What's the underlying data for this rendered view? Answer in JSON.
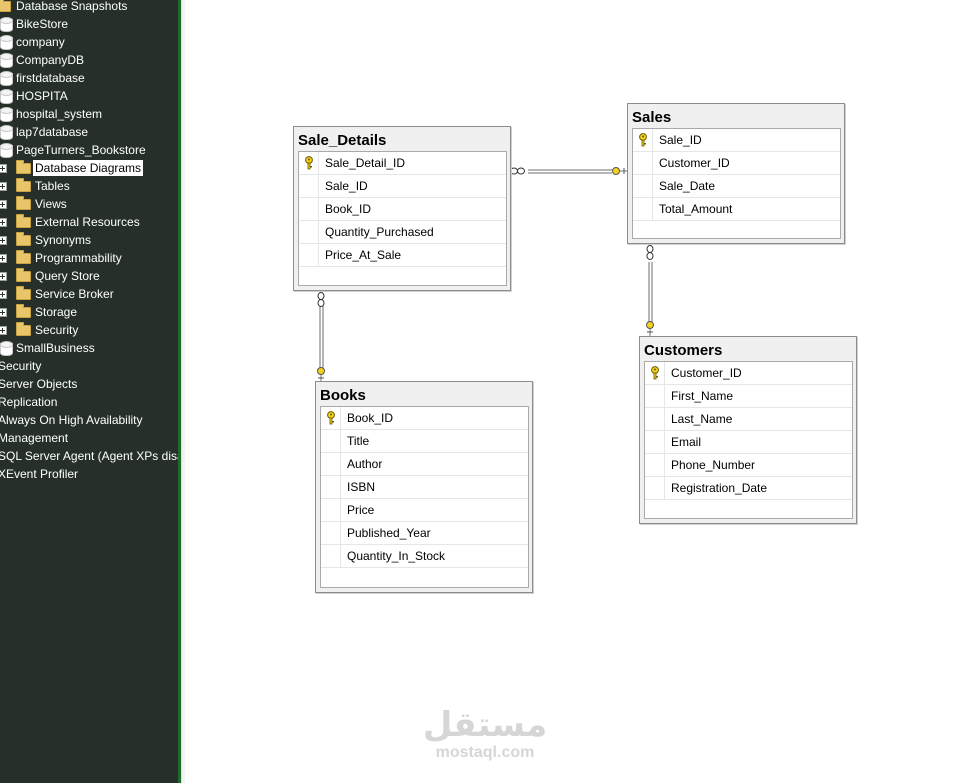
{
  "explorer": {
    "items": [
      {
        "label": "Database Snapshots",
        "icon": "folder-icon",
        "expander": false,
        "selected": false
      },
      {
        "label": "BikeStore",
        "icon": "database-icon",
        "expander": false,
        "selected": false
      },
      {
        "label": "company",
        "icon": "database-icon",
        "expander": false,
        "selected": false
      },
      {
        "label": "CompanyDB",
        "icon": "database-icon",
        "expander": false,
        "selected": false
      },
      {
        "label": "firstdatabase",
        "icon": "database-icon",
        "expander": false,
        "selected": false
      },
      {
        "label": "HOSPITA",
        "icon": "database-icon",
        "expander": false,
        "selected": false
      },
      {
        "label": "hospital_system",
        "icon": "database-icon",
        "expander": false,
        "selected": false
      },
      {
        "label": "lap7database",
        "icon": "database-icon",
        "expander": false,
        "selected": false
      },
      {
        "label": "PageTurners_Bookstore",
        "icon": "database-icon",
        "expander": false,
        "selected": false
      },
      {
        "label": "Database Diagrams",
        "icon": "folder-icon",
        "expander": true,
        "selected": true
      },
      {
        "label": "Tables",
        "icon": "folder-icon",
        "expander": true,
        "selected": false
      },
      {
        "label": "Views",
        "icon": "folder-icon",
        "expander": true,
        "selected": false
      },
      {
        "label": "External Resources",
        "icon": "folder-icon",
        "expander": true,
        "selected": false
      },
      {
        "label": "Synonyms",
        "icon": "folder-icon",
        "expander": true,
        "selected": false
      },
      {
        "label": "Programmability",
        "icon": "folder-icon",
        "expander": true,
        "selected": false
      },
      {
        "label": "Query Store",
        "icon": "folder-icon",
        "expander": true,
        "selected": false
      },
      {
        "label": "Service Broker",
        "icon": "folder-icon",
        "expander": true,
        "selected": false
      },
      {
        "label": "Storage",
        "icon": "folder-icon",
        "expander": true,
        "selected": false
      },
      {
        "label": "Security",
        "icon": "folder-icon",
        "expander": true,
        "selected": false
      },
      {
        "label": "SmallBusiness",
        "icon": "database-icon",
        "expander": false,
        "selected": false
      },
      {
        "label": "Security",
        "icon": "none",
        "expander": false,
        "selected": false
      },
      {
        "label": "Server Objects",
        "icon": "none",
        "expander": false,
        "selected": false
      },
      {
        "label": "Replication",
        "icon": "none",
        "expander": false,
        "selected": false
      },
      {
        "label": "Always On High Availability",
        "icon": "none",
        "expander": false,
        "selected": false
      },
      {
        "label": "Management",
        "icon": "none",
        "expander": false,
        "selected": false
      },
      {
        "label": "SQL Server Agent (Agent XPs disab",
        "icon": "none",
        "expander": false,
        "selected": false
      },
      {
        "label": "XEvent Profiler",
        "icon": "none",
        "expander": false,
        "selected": false
      }
    ]
  },
  "diagram": {
    "tables": {
      "sale_details": {
        "title": "Sale_Details",
        "columns": [
          {
            "name": "Sale_Detail_ID",
            "key": true
          },
          {
            "name": "Sale_ID",
            "key": false
          },
          {
            "name": "Book_ID",
            "key": false
          },
          {
            "name": "Quantity_Purchased",
            "key": false
          },
          {
            "name": "Price_At_Sale",
            "key": false
          }
        ]
      },
      "sales": {
        "title": "Sales",
        "columns": [
          {
            "name": "Sale_ID",
            "key": true
          },
          {
            "name": "Customer_ID",
            "key": false
          },
          {
            "name": "Sale_Date",
            "key": false
          },
          {
            "name": "Total_Amount",
            "key": false
          }
        ]
      },
      "books": {
        "title": "Books",
        "columns": [
          {
            "name": "Book_ID",
            "key": true
          },
          {
            "name": "Title",
            "key": false
          },
          {
            "name": "Author",
            "key": false
          },
          {
            "name": "ISBN",
            "key": false
          },
          {
            "name": "Price",
            "key": false
          },
          {
            "name": "Published_Year",
            "key": false
          },
          {
            "name": "Quantity_In_Stock",
            "key": false
          }
        ]
      },
      "customers": {
        "title": "Customers",
        "columns": [
          {
            "name": "Customer_ID",
            "key": true
          },
          {
            "name": "First_Name",
            "key": false
          },
          {
            "name": "Last_Name",
            "key": false
          },
          {
            "name": "Email",
            "key": false
          },
          {
            "name": "Phone_Number",
            "key": false
          },
          {
            "name": "Registration_Date",
            "key": false
          }
        ]
      }
    }
  },
  "watermark": {
    "logo": "مستقل",
    "url": "mostaql.com"
  },
  "colors": {
    "explorer_bg": "#263029",
    "key_icon": "#f2d21b",
    "relation_line": "#6e6e6e"
  }
}
